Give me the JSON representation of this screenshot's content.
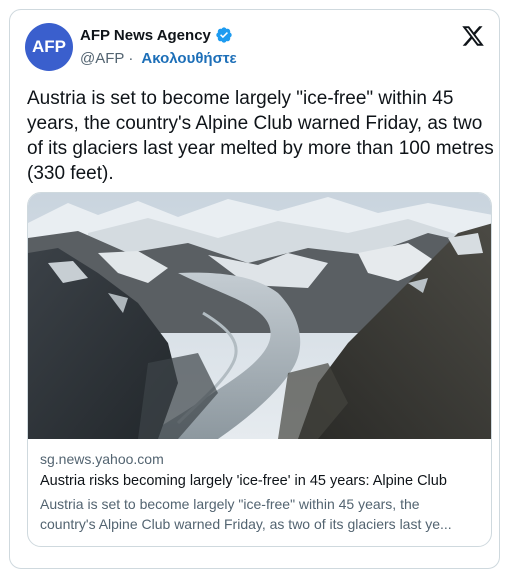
{
  "author": {
    "avatar_text": "AFP",
    "name": "AFP News Agency",
    "handle": "@AFP",
    "separator": "·",
    "follow_label": "Ακολουθήστε"
  },
  "tweet": {
    "text": "Austria is set to become largely \"ice-free\" within 45 years, the country's Alpine Club warned Friday, as two of its glaciers last year melted by more than 100 metres (330 feet)."
  },
  "link_card": {
    "domain": "sg.news.yahoo.com",
    "title": "Austria risks becoming largely 'ice-free' in 45 years: Alpine Club",
    "description_line1": "Austria is set to become largely \"ice-free\" within 45 years, the",
    "description_line2": "country's Alpine Club warned Friday, as two of its glaciers last ye...",
    "image": "glacier-valley-photo"
  },
  "colors": {
    "avatar_bg": "#3a5fcd",
    "verified": "#1d9bf0",
    "follow": "#1d6fb8",
    "muted": "#536471"
  }
}
